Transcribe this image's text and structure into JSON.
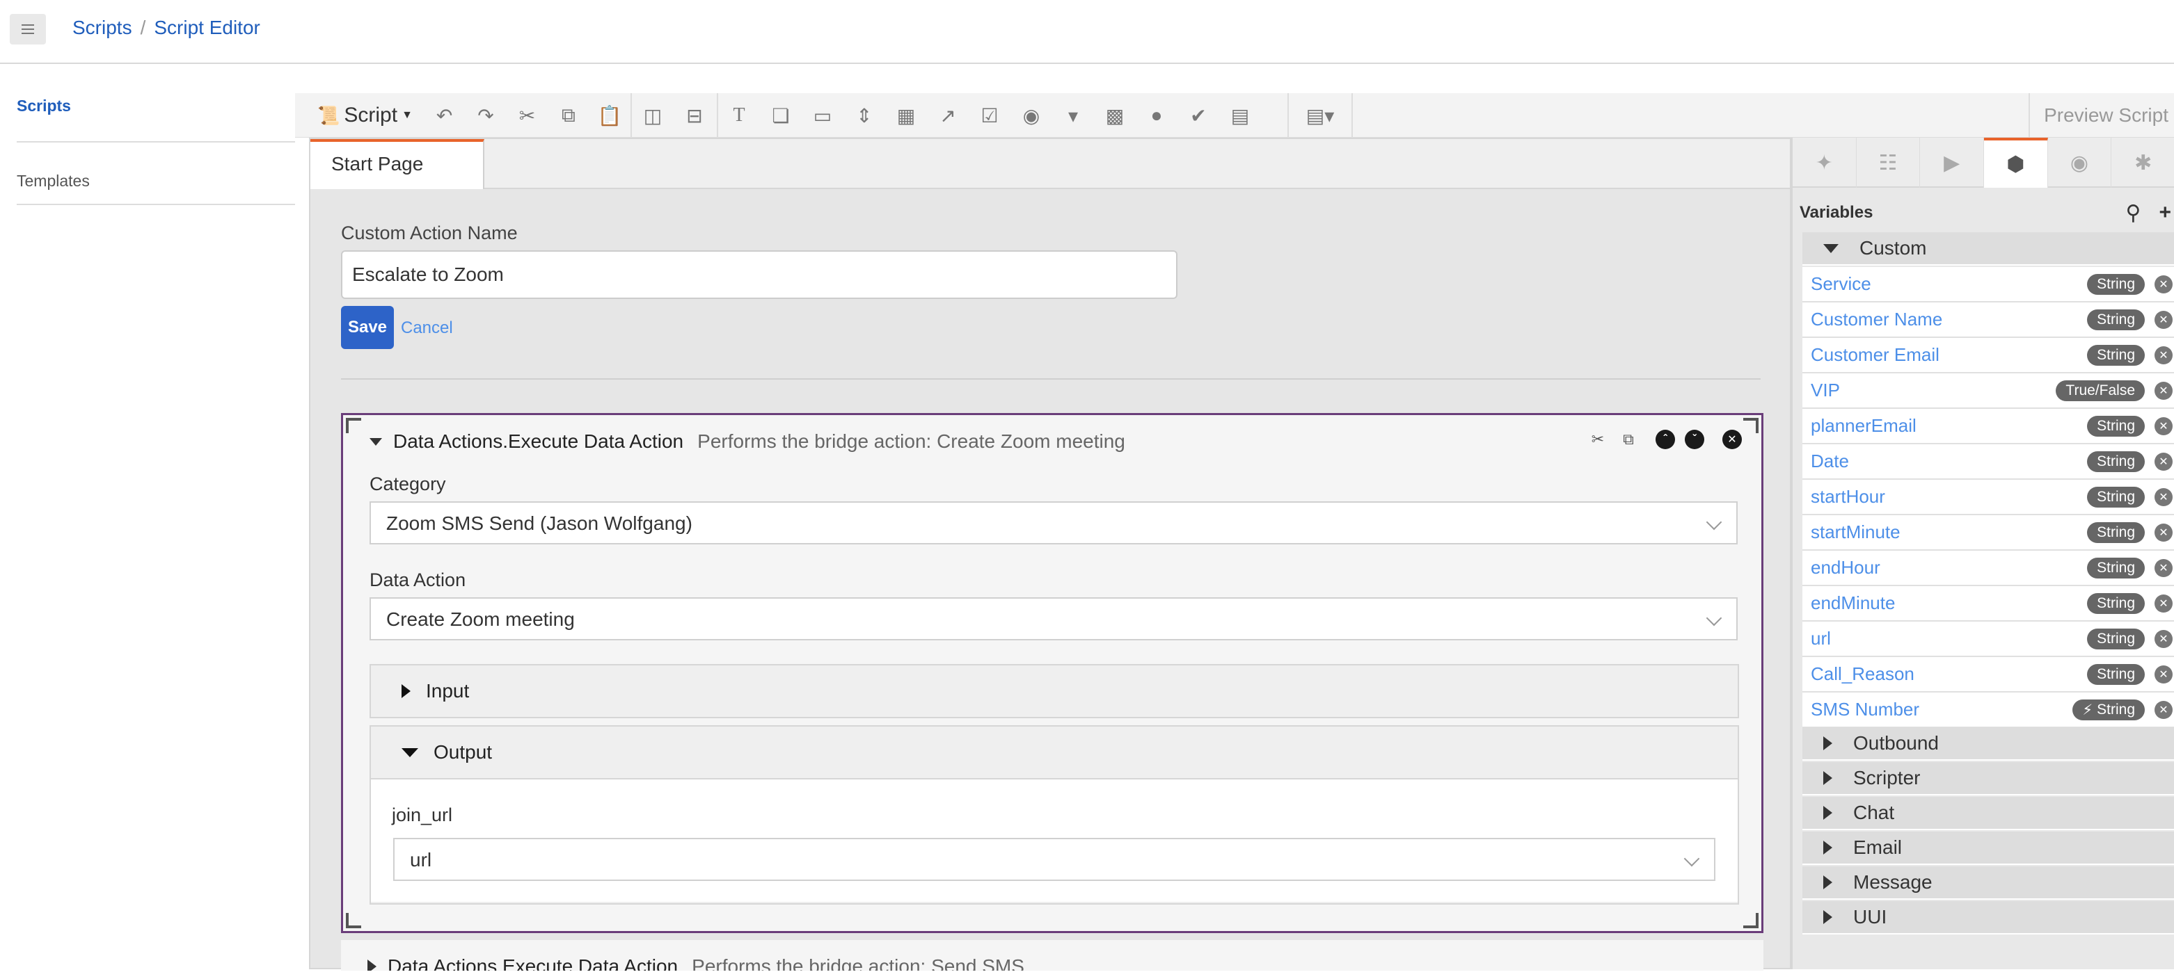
{
  "header": {
    "menu_icon": "hamburger-icon",
    "breadcrumb": [
      "Scripts",
      "Script Editor"
    ]
  },
  "sidebar": {
    "items": [
      {
        "label": "Scripts",
        "active": true
      },
      {
        "label": "Templates",
        "active": false
      }
    ]
  },
  "toolbar": {
    "script_menu": "Script",
    "preview_label": "Preview Script"
  },
  "page_tab": "Start Page",
  "custom_action": {
    "label": "Custom Action Name",
    "value": "Escalate to Zoom",
    "save_label": "Save",
    "cancel_label": "Cancel"
  },
  "action_card": {
    "title": "Data Actions.Execute Data Action",
    "description": "Performs the bridge action: Create Zoom meeting",
    "category_label": "Category",
    "category_value": "Zoom SMS Send (Jason Wolfgang)",
    "data_action_label": "Data Action",
    "data_action_value": "Create Zoom meeting",
    "input_label": "Input",
    "output_label": "Output",
    "output_field_label": "join_url",
    "output_field_value": "url"
  },
  "next_card": {
    "title": "Data Actions.Execute Data Action",
    "description": "Performs the bridge action: Send SMS"
  },
  "variables_panel": {
    "title": "Variables",
    "custom_group": "Custom",
    "variables": [
      {
        "name": "Service",
        "type": "String"
      },
      {
        "name": "Customer Name",
        "type": "String"
      },
      {
        "name": "Customer Email",
        "type": "String"
      },
      {
        "name": "VIP",
        "type": "True/False"
      },
      {
        "name": "plannerEmail",
        "type": "String"
      },
      {
        "name": "Date",
        "type": "String"
      },
      {
        "name": "startHour",
        "type": "String"
      },
      {
        "name": "startMinute",
        "type": "String"
      },
      {
        "name": "endHour",
        "type": "String"
      },
      {
        "name": "endMinute",
        "type": "String"
      },
      {
        "name": "url",
        "type": "String"
      },
      {
        "name": "Call_Reason",
        "type": "String"
      },
      {
        "name": "SMS Number",
        "type": "String"
      }
    ],
    "other_groups": [
      "Outbound",
      "Scripter",
      "Chat",
      "Email",
      "Message",
      "UUI"
    ]
  },
  "colors": {
    "link": "#1f5dbb",
    "accent_tab": "#e8632b",
    "primary_button": "#2d63c8",
    "card_border": "#6a3d7a"
  }
}
